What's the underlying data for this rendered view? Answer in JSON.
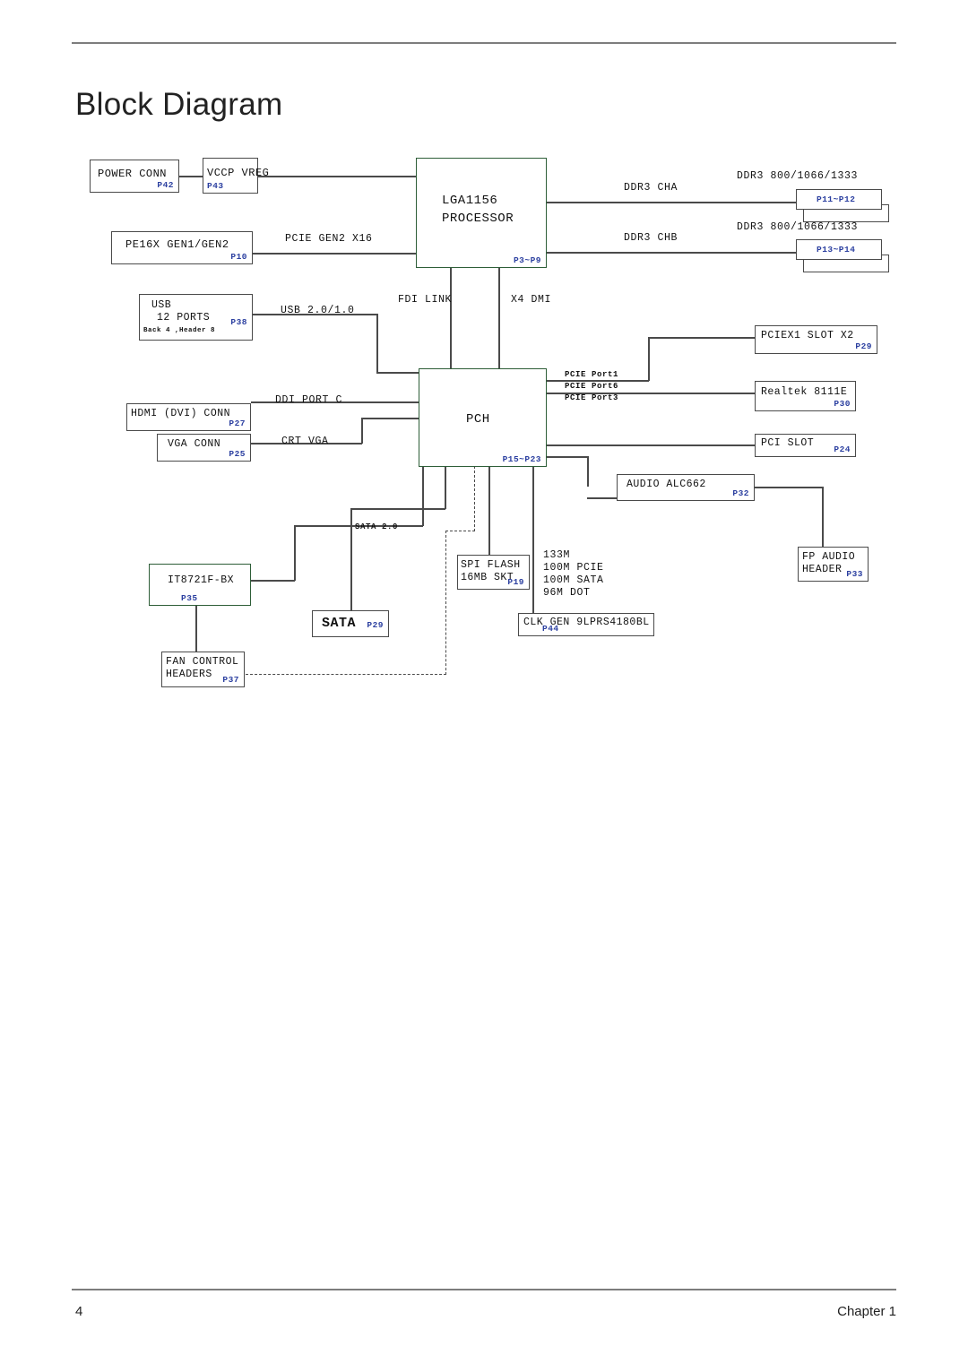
{
  "page": {
    "title": "Block Diagram",
    "footer_page_number": "4",
    "footer_chapter": "Chapter 1"
  },
  "theme": {
    "accent_pin_color": "#2b3fa0",
    "block_border": "#4a4a4a",
    "highlight_border": "#2e5e38",
    "background": "#ffffff"
  },
  "diagram": {
    "type": "block-diagram",
    "blocks": [
      {
        "id": "power_conn",
        "label": "POWER CONN",
        "pin": "P42",
        "highlight": false
      },
      {
        "id": "vccp_vreg",
        "label": "VCCP VREG",
        "pin": "P43",
        "highlight": false
      },
      {
        "id": "pe16x",
        "label": "PE16X GEN1/GEN2",
        "pin": "P10",
        "highlight": false
      },
      {
        "id": "cpu",
        "label": "LGA1156",
        "label2": "PROCESSOR",
        "pin": "P3~P9",
        "highlight": true
      },
      {
        "id": "dimm_a",
        "label": "",
        "pin": "P11~P12",
        "highlight": false
      },
      {
        "id": "dimm_b",
        "label": "",
        "pin": "P13~P14",
        "highlight": false
      },
      {
        "id": "usb",
        "label": "USB",
        "label2": "12 PORTS",
        "label3": "Back 4 ,Header 8",
        "pin": "P38",
        "highlight": false
      },
      {
        "id": "pch",
        "label": "PCH",
        "pin": "P15~P23",
        "highlight": true
      },
      {
        "id": "pciex1",
        "label": "PCIEX1 SLOT X2",
        "pin": "P29",
        "highlight": false
      },
      {
        "id": "realtek",
        "label": "Realtek 8111E",
        "pin": "P30",
        "highlight": false
      },
      {
        "id": "pci_slot",
        "label": "PCI SLOT",
        "pin": "P24",
        "highlight": false
      },
      {
        "id": "hdmi",
        "label": "HDMI (DVI) CONN",
        "pin": "P27",
        "highlight": false
      },
      {
        "id": "vga",
        "label": "VGA CONN",
        "pin": "P25",
        "highlight": false
      },
      {
        "id": "audio",
        "label": "AUDIO ALC662",
        "pin": "P32",
        "highlight": false
      },
      {
        "id": "fp_audio",
        "label": "FP AUDIO",
        "label2": "HEADER",
        "pin": "P33",
        "highlight": false
      },
      {
        "id": "spi_flash",
        "label": "SPI FLASH",
        "label2": "16MB SKT",
        "pin": "P19",
        "highlight": false
      },
      {
        "id": "clk_gen",
        "label": "CLK GEN 9LPRS4180BL",
        "pin": "P44",
        "highlight": false
      },
      {
        "id": "it8721",
        "label": "IT8721F-BX",
        "pin": "P35",
        "highlight": true
      },
      {
        "id": "sata",
        "label": "SATA",
        "pin": "P29",
        "highlight": false
      },
      {
        "id": "fan_ctrl",
        "label": "FAN CONTROL",
        "label2": "HEADERS",
        "pin": "P37",
        "highlight": false
      }
    ],
    "connection_labels": [
      {
        "id": "pcie_gen2_x16",
        "text": "PCIE GEN2 X16"
      },
      {
        "id": "ddr3_cha",
        "text": "DDR3 CHA"
      },
      {
        "id": "ddr3_chb",
        "text": "DDR3 CHB"
      },
      {
        "id": "ddr3_speed_a",
        "text": "DDR3 800/1066/1333"
      },
      {
        "id": "ddr3_speed_b",
        "text": "DDR3 800/1066/1333"
      },
      {
        "id": "fdi_link",
        "text": "FDI LINK"
      },
      {
        "id": "x4_dmi",
        "text": "X4 DMI"
      },
      {
        "id": "usb_ver",
        "text": "USB 2.0/1.0"
      },
      {
        "id": "ddi_port_c",
        "text": "DDI PORT C"
      },
      {
        "id": "crt_vga",
        "text": "CRT VGA"
      },
      {
        "id": "pcie_port1",
        "text": "PCIE Port1"
      },
      {
        "id": "pcie_port6",
        "text": "PCIE Port6"
      },
      {
        "id": "pcie_port3",
        "text": "PCIE Port3"
      },
      {
        "id": "sata_ver",
        "text": "SATA 2.0"
      }
    ],
    "clock_outputs": [
      "133M",
      "100M PCIE",
      "100M SATA",
      "96M DOT"
    ]
  }
}
